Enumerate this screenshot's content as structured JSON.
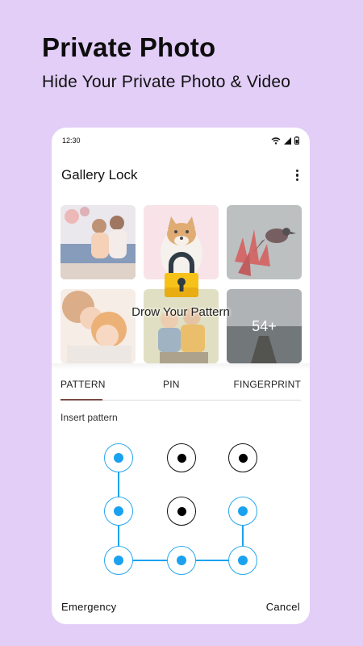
{
  "promo": {
    "title": "Private Photo",
    "subtitle": "Hide Your Private Photo & Video"
  },
  "status_bar": {
    "time": "12:30",
    "icons": [
      "wifi-icon",
      "signal-icon",
      "battery-icon"
    ]
  },
  "app_bar": {
    "title": "Gallery Lock",
    "menu_icon": "more-vert-icon"
  },
  "gallery": {
    "thumbnails": [
      {
        "subject": "mother-and-daughter-on-sofa"
      },
      {
        "subject": "shiba-dog"
      },
      {
        "subject": "bird-on-red-flowers"
      },
      {
        "subject": "mother-hugging-child"
      },
      {
        "subject": "two-children"
      },
      {
        "subject": "boat-on-lake"
      }
    ],
    "more_count": "54+",
    "lock_icon": "padlock-icon",
    "lock_caption": "Drow Your Pattern"
  },
  "tabs": [
    {
      "label": "PATTERN",
      "selected": true
    },
    {
      "label": "PIN",
      "selected": false
    },
    {
      "label": "FINGERPRINT",
      "selected": false
    }
  ],
  "pattern_pad": {
    "instruction": "Insert pattern",
    "grid": [
      [
        true,
        false,
        false
      ],
      [
        true,
        false,
        true
      ],
      [
        true,
        true,
        true
      ]
    ],
    "path_order": [
      [
        1,
        1
      ],
      [
        2,
        1
      ],
      [
        3,
        1
      ],
      [
        3,
        2
      ],
      [
        3,
        3
      ],
      [
        2,
        3
      ]
    ]
  },
  "footer": {
    "emergency_label": "Emergency",
    "cancel_label": "Cancel"
  },
  "colors": {
    "background": "#e2cef7",
    "accent_blue": "#1aa2f0",
    "tab_indicator": "#7a4b45"
  }
}
